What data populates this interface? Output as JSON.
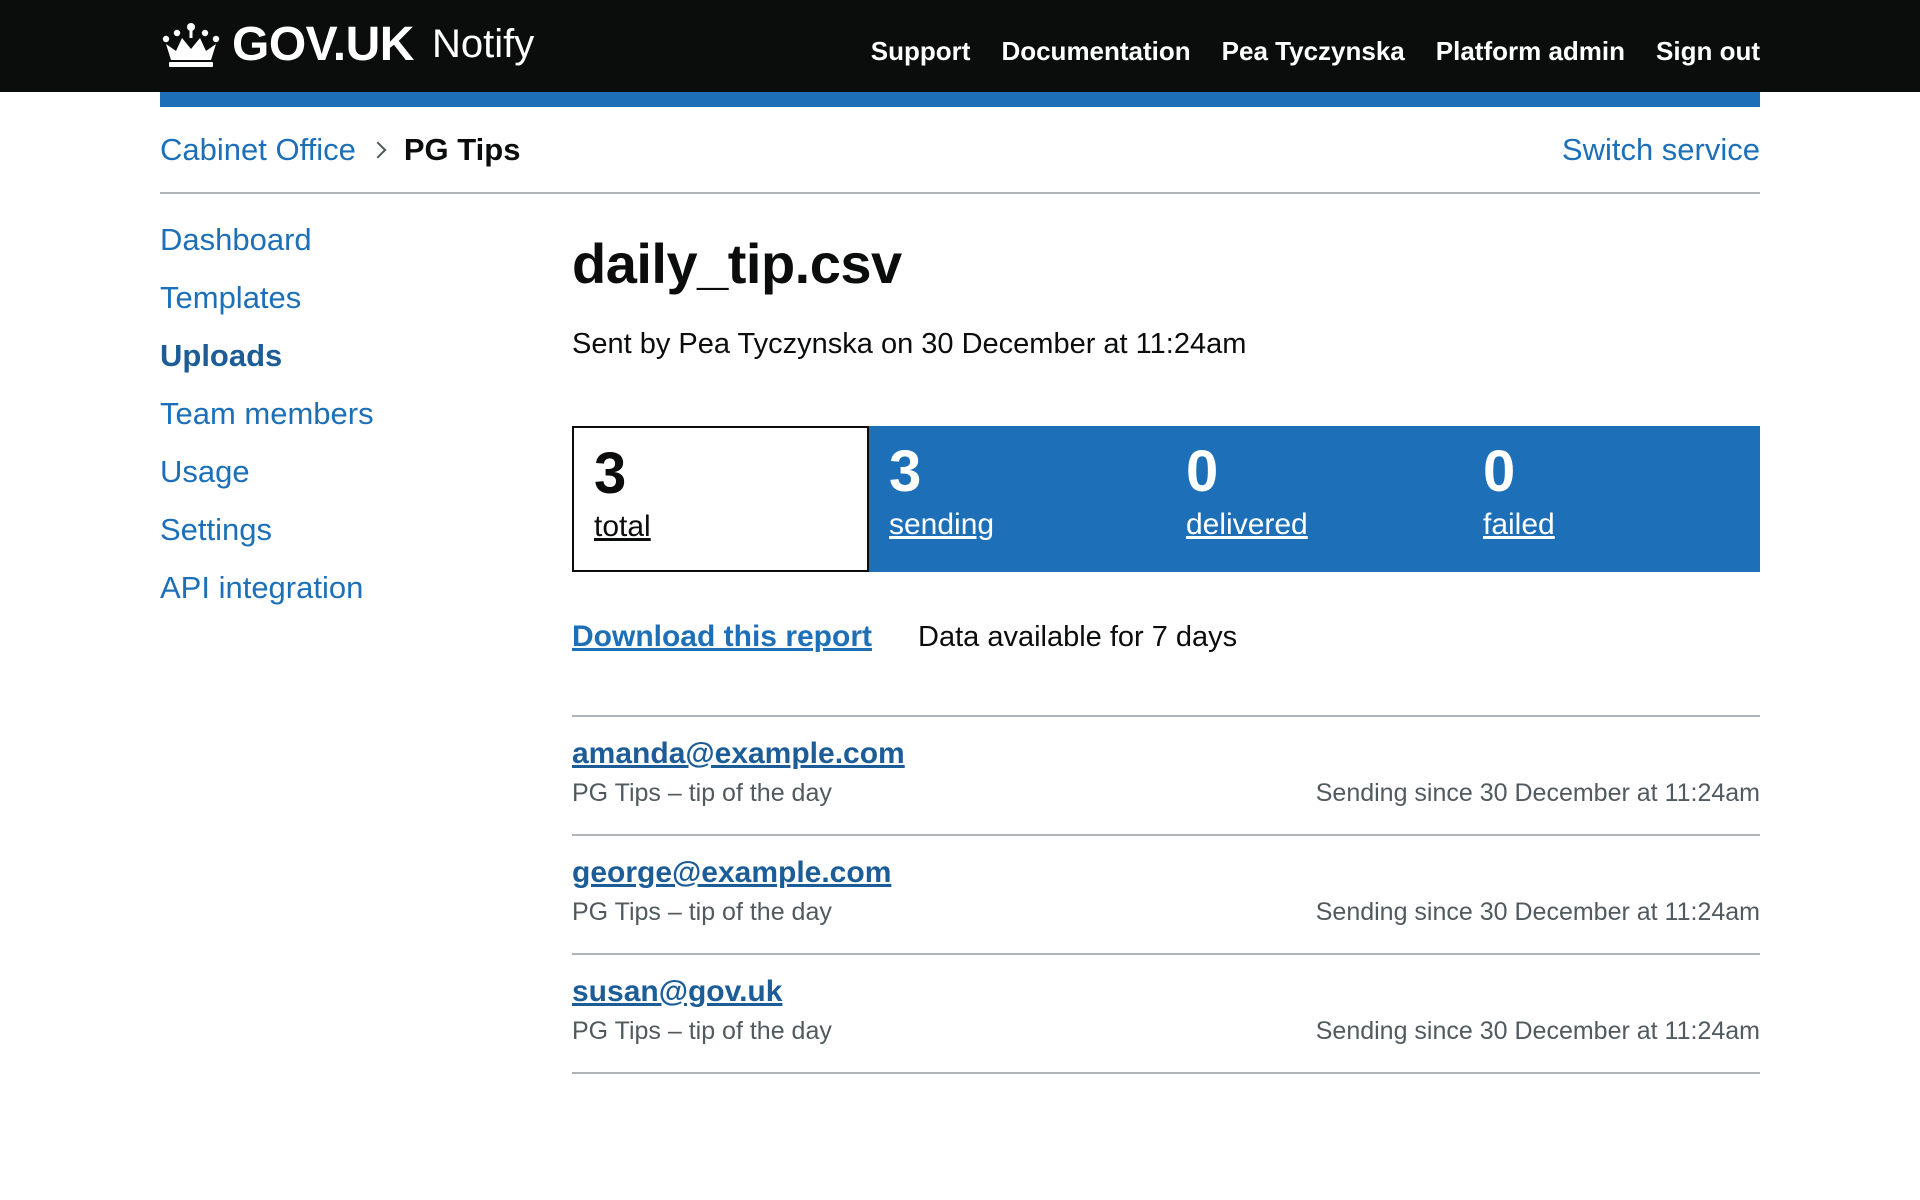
{
  "header": {
    "logo_text": "GOV.UK",
    "product_name": "Notify",
    "nav": [
      "Support",
      "Documentation",
      "Pea Tyczynska",
      "Platform admin",
      "Sign out"
    ]
  },
  "service_bar": {
    "organisation": "Cabinet Office",
    "service": "PG Tips",
    "switch_service": "Switch service"
  },
  "side_nav": {
    "items": [
      {
        "label": "Dashboard",
        "current": false
      },
      {
        "label": "Templates",
        "current": false
      },
      {
        "label": "Uploads",
        "current": true
      },
      {
        "label": "Team members",
        "current": false
      },
      {
        "label": "Usage",
        "current": false
      },
      {
        "label": "Settings",
        "current": false
      },
      {
        "label": "API integration",
        "current": false
      }
    ]
  },
  "main": {
    "title": "daily_tip.csv",
    "sent_by": "Sent by Pea Tyczynska on 30 December at 11:24am",
    "counts": [
      {
        "number": "3",
        "label": "total"
      },
      {
        "number": "3",
        "label": "sending"
      },
      {
        "number": "0",
        "label": "delivered"
      },
      {
        "number": "0",
        "label": "failed"
      }
    ],
    "download_link": "Download this report",
    "data_available": "Data available for 7 days",
    "notifications": [
      {
        "recipient": "amanda@example.com",
        "template": "PG Tips – tip of the day",
        "status": "Sending since 30 December at 11:24am"
      },
      {
        "recipient": "george@example.com",
        "template": "PG Tips – tip of the day",
        "status": "Sending since 30 December at 11:24am"
      },
      {
        "recipient": "susan@gov.uk",
        "template": "PG Tips – tip of the day",
        "status": "Sending since 30 December at 11:24am"
      }
    ]
  },
  "colors": {
    "header_bg": "#0b0c0c",
    "brand_blue": "#1d70b8",
    "link": "#1d70b8",
    "secondary_text": "#505a5f",
    "border": "#b1b4b6"
  },
  "icons": {
    "logo": "crown-icon",
    "breadcrumb_separator": "chevron-right-icon"
  }
}
